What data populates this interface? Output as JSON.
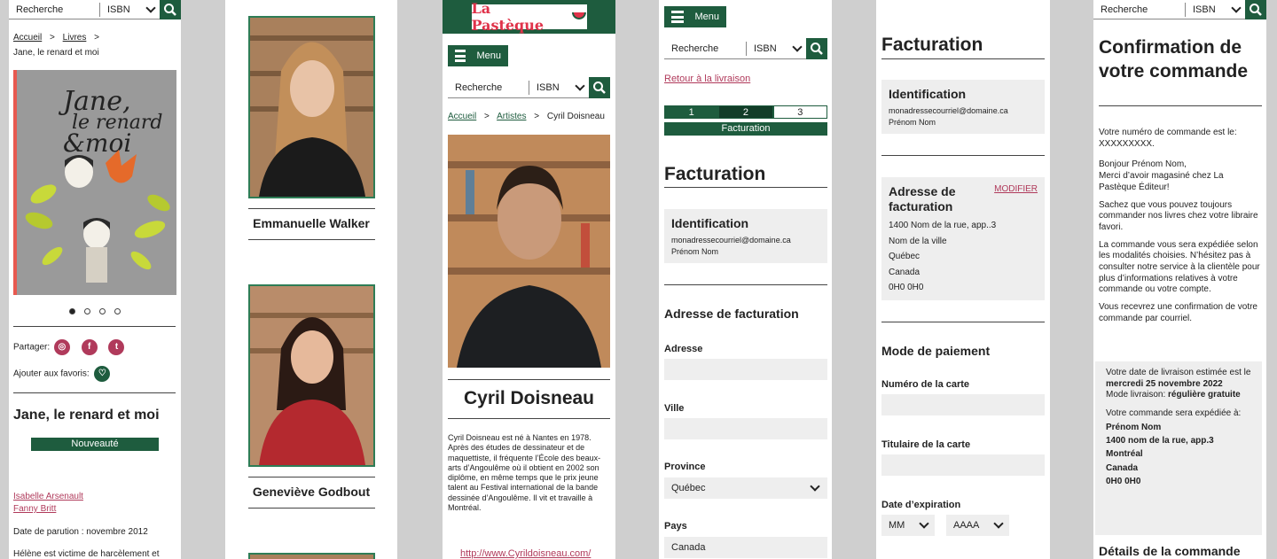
{
  "search": {
    "placeholder": "Recherche",
    "isbn": "ISBN"
  },
  "p1": {
    "breadcrumb": [
      "Accueil",
      ">",
      "Livres",
      ">"
    ],
    "current": "Jane, le renard et moi",
    "cover": {
      "title_line1": "Jane,",
      "title_line2": "le renard",
      "title_line3": "&moi"
    },
    "share_label": "Partager:",
    "fav_label": "Ajouter aux favoris:",
    "title": "Jane, le renard et moi",
    "badge": "Nouveauté",
    "authors": [
      "Isabelle Arsenault",
      "Fanny Britt"
    ],
    "date": "Date de parution : novembre 2012",
    "desc": "Hélène est victime de harcèlement et d’intimidation à son école. Elle trouve"
  },
  "p2": {
    "artist1": "Emmanuelle Walker",
    "artist2": "Geneviève Godbout"
  },
  "p3": {
    "logo": "La Pastèque",
    "menu": "Menu",
    "breadcrumb": [
      "Accueil",
      ">",
      "Artistes",
      ">",
      "Cyril Doisneau"
    ],
    "name": "Cyril Doisneau",
    "bio": "Cyril Doisneau est né à Nantes en 1978. Après des études de dessinateur et de maquettiste, il fréquente l’École des beaux-arts d’Angoulême où il obtient en 2002 son diplôme, en même temps que le prix jeune talent au Festival international de la bande dessinée d’Angoulême. Il vit et travaille à Montréal.",
    "url": "http://www.Cyrildoisneau.com/"
  },
  "p4": {
    "menu": "Menu",
    "back": "Retour à la livraison",
    "steps": [
      "1",
      "2",
      "3"
    ],
    "step_label": "Facturation",
    "heading": "Facturation",
    "ident_title": "Identification",
    "email": "monadressecourriel@domaine.ca",
    "name": "Prénom Nom",
    "addr_heading": "Adresse de facturation",
    "f_address": "Adresse",
    "f_city": "Ville",
    "f_province": "Province",
    "province_val": "Québec",
    "f_country": "Pays",
    "country_val": "Canada"
  },
  "p5": {
    "heading": "Facturation",
    "ident_title": "Identification",
    "email": "monadressecourriel@domaine.ca",
    "name": "Prénom Nom",
    "addr_title": "Adresse de facturation",
    "modify": "MODIFIER",
    "addr": [
      "1400 Nom de la rue, app..3",
      "Nom de la ville",
      "Québec",
      "Canada",
      "0H0 0H0"
    ],
    "pay_heading": "Mode de paiement",
    "card_num": "Numéro de la carte",
    "card_holder": "Titulaire de la carte",
    "exp": "Date d’expiration",
    "mm": "MM",
    "yyyy": "AAAA"
  },
  "p6": {
    "heading": "Confirmation de votre commande",
    "order_line1": "Votre numéro de commande est le:",
    "order_line2": "XXXXXXXXX.",
    "greet1": "Bonjour Prénom Nom,",
    "greet2": "Merci d’avoir magasiné chez La Pastèque Éditeur!",
    "para1": "Sachez que vous pouvez toujours commander nos livres chez votre libraire favori.",
    "para2": "La commande vous sera expédiée selon les modalités choisies. N’hésitez pas à consulter notre service à la clientèle pour plus d’informations relatives à votre commande ou votre compte.",
    "para3": "Vous recevrez une confirmation de votre commande par courriel.",
    "est_pre": "Votre date de livraison estimée est le ",
    "est_date": "mercredi 25 novembre 2022",
    "mode_pre": "Mode livraison: ",
    "mode_val": "régulière gratuite",
    "ship_pre": "Votre commande sera expédiée à:",
    "ship": [
      "Prénom Nom",
      "1400 nom de la rue, app.3",
      "Montréal",
      "Canada",
      "0H0 0H0"
    ],
    "details": "Détails de la commande"
  },
  "colors": {
    "brand_green": "#1e5c3e",
    "link": "#b03a5b",
    "logo_red": "#e0334a"
  }
}
